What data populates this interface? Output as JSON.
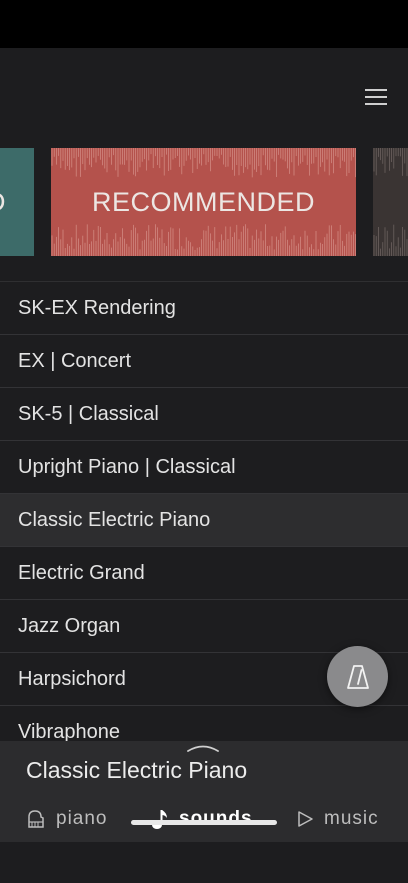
{
  "header": {
    "menu_icon": "hamburger-menu-icon"
  },
  "carousel": {
    "cards": [
      {
        "label": "D",
        "color": "#3d6b69"
      },
      {
        "label": "RECOMMENDED",
        "color": "#b4524c"
      },
      {
        "label": "",
        "color": "#3a3433"
      }
    ]
  },
  "sound_list": {
    "items": [
      {
        "label": "SK-EX Rendering"
      },
      {
        "label": "EX | Concert"
      },
      {
        "label": "SK-5 | Classical"
      },
      {
        "label": "Upright Piano | Classical"
      },
      {
        "label": "Classic Electric Piano",
        "selected": true
      },
      {
        "label": "Electric Grand"
      },
      {
        "label": "Jazz Organ"
      },
      {
        "label": "Harpsichord"
      },
      {
        "label": "Vibraphone"
      }
    ]
  },
  "metronome": {
    "icon": "metronome-icon"
  },
  "now_playing": {
    "title": "Classic Electric Piano",
    "handle_icon": "chevron-up-icon"
  },
  "tabs": [
    {
      "label": "piano",
      "icon": "grand-piano-icon"
    },
    {
      "label": "sounds",
      "icon": "music-note-icon",
      "active": true
    },
    {
      "label": "music",
      "icon": "play-icon"
    }
  ],
  "colors": {
    "accent": "#b4524c",
    "teal": "#3d6b69",
    "background": "#1d1d1f"
  }
}
